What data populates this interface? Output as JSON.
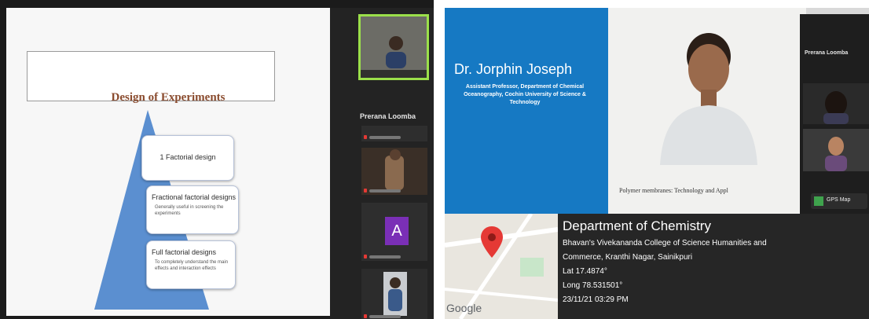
{
  "conference": {
    "slide": {
      "title": "Design of Experiments",
      "stages": [
        {
          "title": "1 Factorial design",
          "note": ""
        },
        {
          "title": "Fractional factorial designs",
          "note": "Generally useful in screening the experiments"
        },
        {
          "title": "Full factorial designs",
          "note": "To completely understand the main effects and interaction effects"
        }
      ]
    },
    "participant_name": "Prerana Loomba",
    "avatar_letter": "A"
  },
  "photo": {
    "speaker_name": "Dr. Jorphin Joseph",
    "speaker_designation": "Assistant Professor, Department of Chemical Oceanography, Cochin University of Science & Technology",
    "talk_title": "Polymer membranes: Technology and Appl",
    "right_participant_name": "Prerana Loomba",
    "gps_badge": "GPS Map"
  },
  "gps": {
    "map_brand": "Google",
    "place": "Department of Chemistry",
    "address_line1": "Bhavan's Vivekananda College of Science Humanities and",
    "address_line2": "Commerce, Kranthi Nagar, Sainikpuri",
    "lat": "Lat 17.4874°",
    "long": "Long 78.531501°",
    "datetime": "23/11/21 03:29 PM"
  },
  "colors": {
    "slide_blue": "#1679c3",
    "active_speaker_border": "#9be04a",
    "pyramid_blue": "#5b8fd0",
    "map_pin_red": "#e53935",
    "avatar_purple": "#7a2fb6"
  }
}
